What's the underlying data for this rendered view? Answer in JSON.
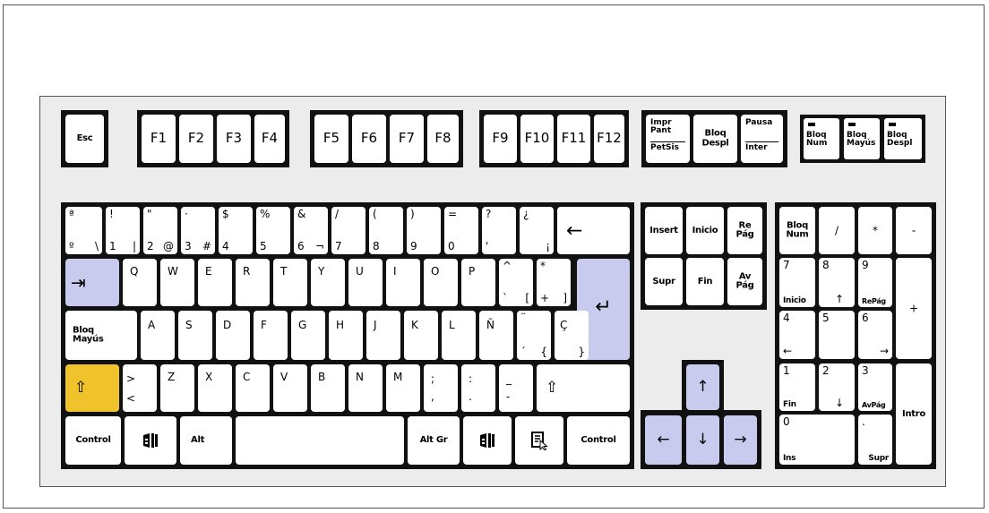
{
  "colors": {
    "background": "#ffffff",
    "board": "#ececec",
    "key": "#ffffff",
    "key_group": "#111111",
    "highlight_blue": "#c8cbed",
    "highlight_yellow": "#f0c22b"
  },
  "fn_row": {
    "esc": "Esc",
    "f1": "F1",
    "f2": "F2",
    "f3": "F3",
    "f4": "F4",
    "f5": "F5",
    "f6": "F6",
    "f7": "F7",
    "f8": "F8",
    "f9": "F9",
    "f10": "F10",
    "f11": "F11",
    "f12": "F12",
    "impr_top": "Impr\nPant",
    "impr_bottom": "PetSis",
    "bloq_despl": "Bloq\nDespl",
    "pausa_top": "Pausa",
    "pausa_bottom": "Inter"
  },
  "indicators": {
    "num": "Bloq\nNum",
    "mayus": "Bloq\nMayús",
    "despl": "Bloq\nDespl"
  },
  "row1": {
    "ordinal_top": "ª",
    "ordinal_bottom": "º",
    "ordinal_alt": "\\",
    "k1_top": "!",
    "k1_bottom": "1",
    "k1_alt": "|",
    "k2_top": "\"",
    "k2_bottom": "2",
    "k2_alt": "@",
    "k3_top": "·",
    "k3_bottom": "3",
    "k3_alt": "#",
    "k4_top": "$",
    "k4_bottom": "4",
    "k5_top": "%",
    "k5_bottom": "5",
    "k6_top": "&",
    "k6_bottom": "6",
    "k6_alt": "¬",
    "k7_top": "/",
    "k7_bottom": "7",
    "k8_top": "(",
    "k8_bottom": "8",
    "k9_top": ")",
    "k9_bottom": "9",
    "k0_top": "=",
    "k0_bottom": "0",
    "apos_top": "?",
    "apos_bottom": "'",
    "inv_top": "¿",
    "inv_bottom": "¡",
    "backspace": "←"
  },
  "row2": {
    "tab": "⇥",
    "q": "Q",
    "w": "W",
    "e": "E",
    "r": "R",
    "t": "T",
    "y": "Y",
    "u": "U",
    "i": "I",
    "o": "O",
    "p": "P",
    "grave_top": "^",
    "grave_bottom": "`",
    "grave_alt": "[",
    "plus_top": "*",
    "plus_bottom": "+",
    "plus_alt": "]",
    "enter": "↵"
  },
  "row3": {
    "caps": "Bloq\nMayús",
    "a": "A",
    "s": "S",
    "d": "D",
    "f": "F",
    "g": "G",
    "h": "H",
    "j": "J",
    "k": "K",
    "l": "L",
    "enye": "Ñ",
    "acute_top": "¨",
    "acute_bottom": "´",
    "acute_alt": "{",
    "cedil_top": "Ç",
    "cedil_alt": "}"
  },
  "row4": {
    "shift_left": "⇧",
    "angle_top": ">",
    "angle_bottom": "<",
    "z": "Z",
    "x": "X",
    "c": "C",
    "v": "V",
    "b": "B",
    "n": "N",
    "m": "M",
    "comma_top": ";",
    "comma_bottom": ",",
    "period_top": ":",
    "period_bottom": ".",
    "minus_top": "_",
    "minus_bottom": "-",
    "shift_right": "⇧"
  },
  "row5": {
    "control_left": "Control",
    "win_left": "windows-icon",
    "alt": "Alt",
    "altgr": "Alt Gr",
    "win_right": "windows-icon",
    "menu": "menu-icon",
    "control_right": "Control"
  },
  "nav": {
    "insert": "Insert",
    "inicio": "Inicio",
    "repag": "Re\nPág",
    "supr": "Supr",
    "fin": "Fin",
    "avpag": "Av\nPág"
  },
  "arrows": {
    "up": "↑",
    "left": "←",
    "down": "↓",
    "right": "→"
  },
  "numpad": {
    "bloqnum": "Bloq\nNum",
    "div": "/",
    "mul": "*",
    "minus": "-",
    "n7_top": "7",
    "n7_bottom": "Inicio",
    "n8_top": "8",
    "n8_bottom": "↑",
    "n9_top": "9",
    "n9_bottom": "RePág",
    "plus": "+",
    "n4_top": "4",
    "n4_bottom": "←",
    "n5_top": "5",
    "n6_top": "6",
    "n6_bottom": "→",
    "n1_top": "1",
    "n1_bottom": "Fin",
    "n2_top": "2",
    "n2_bottom": "↓",
    "n3_top": "3",
    "n3_bottom": "AvPág",
    "intro": "Intro",
    "n0_top": "0",
    "n0_bottom": "Ins",
    "dot_top": ".",
    "dot_bottom": "Supr"
  }
}
